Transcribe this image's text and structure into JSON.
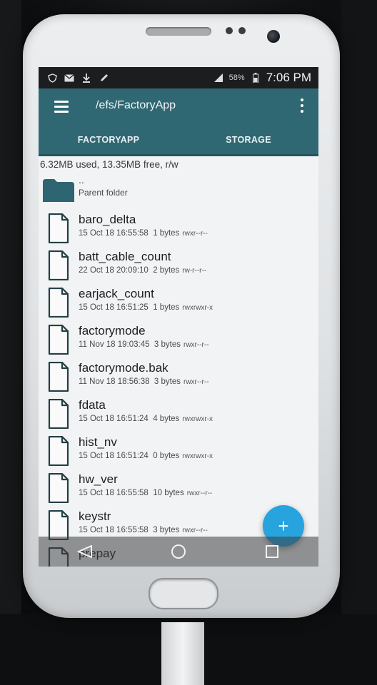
{
  "status_bar": {
    "battery": "58%",
    "time": "7:06 PM"
  },
  "toolbar": {
    "path": "/efs/FactoryApp"
  },
  "tabs": [
    {
      "label": "FACTORYAPP"
    },
    {
      "label": "STORAGE"
    }
  ],
  "summary": "6.32MB used, 13.35MB free, r/w",
  "parent": {
    "name": "..",
    "label": "Parent folder"
  },
  "files": [
    {
      "name": "baro_delta",
      "date": "15 Oct 18 16:55:58",
      "size": "1 bytes",
      "perm": "rwxr--r--"
    },
    {
      "name": "batt_cable_count",
      "date": "22 Oct 18 20:09:10",
      "size": "2 bytes",
      "perm": "rw-r--r--"
    },
    {
      "name": "earjack_count",
      "date": "15 Oct 18 16:51:25",
      "size": "1 bytes",
      "perm": "rwxrwxr-x"
    },
    {
      "name": "factorymode",
      "date": "11 Nov 18 19:03:45",
      "size": "3 bytes",
      "perm": "rwxr--r--"
    },
    {
      "name": "factorymode.bak",
      "date": "11 Nov 18 18:56:38",
      "size": "3 bytes",
      "perm": "rwxr--r--"
    },
    {
      "name": "fdata",
      "date": "15 Oct 18 16:51:24",
      "size": "4 bytes",
      "perm": "rwxrwxr-x"
    },
    {
      "name": "hist_nv",
      "date": "15 Oct 18 16:51:24",
      "size": "0 bytes",
      "perm": "rwxrwxr-x"
    },
    {
      "name": "hw_ver",
      "date": "15 Oct 18 16:55:58",
      "size": "10 bytes",
      "perm": "rwxr--r--"
    },
    {
      "name": "keystr",
      "date": "15 Oct 18 16:55:58",
      "size": "3 bytes",
      "perm": "rwxr--r--"
    },
    {
      "name": "prepay",
      "date": "",
      "size": "",
      "perm": ""
    }
  ],
  "fab": {
    "label": "+"
  },
  "colors": {
    "toolbar": "#2f6873",
    "fab": "#27a3de"
  }
}
